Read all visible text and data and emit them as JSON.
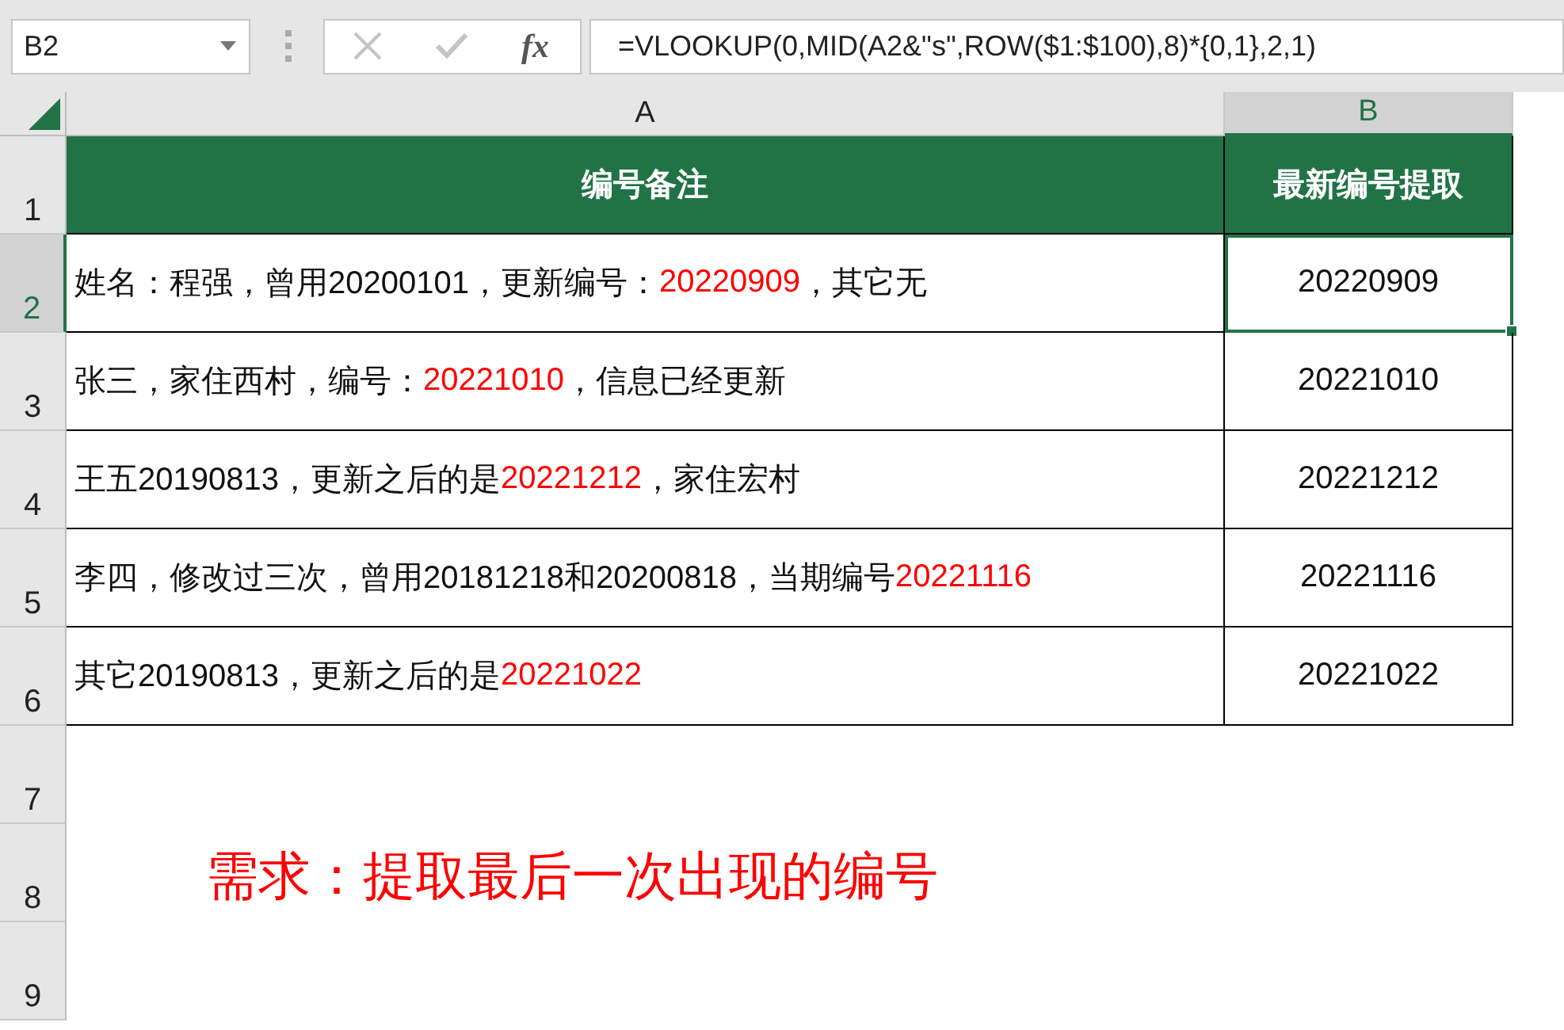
{
  "name_box": {
    "value": "B2"
  },
  "formula_bar": {
    "fx": "fx",
    "formula": "=VLOOKUP(0,MID(A2&\"s\",ROW($1:$100),8)*{0,1},2,1)"
  },
  "columns": [
    {
      "label": "A",
      "selected": false
    },
    {
      "label": "B",
      "selected": true
    }
  ],
  "rows": [
    {
      "number": "1",
      "selected": false,
      "kind": "header",
      "a": "编号备注",
      "b": "最新编号提取"
    },
    {
      "number": "2",
      "selected": true,
      "kind": "data",
      "a": [
        {
          "text": "姓名：程强，曾用20200101，更新编号：",
          "highlight": false
        },
        {
          "text": "20220909",
          "highlight": true
        },
        {
          "text": "，其它无",
          "highlight": false
        }
      ],
      "b": "20220909"
    },
    {
      "number": "3",
      "selected": false,
      "kind": "data",
      "a": [
        {
          "text": "张三，家住西村，编号：",
          "highlight": false
        },
        {
          "text": "20221010",
          "highlight": true
        },
        {
          "text": "，信息已经更新",
          "highlight": false
        }
      ],
      "b": "20221010"
    },
    {
      "number": "4",
      "selected": false,
      "kind": "data",
      "a": [
        {
          "text": "王五20190813，更新之后的是",
          "highlight": false
        },
        {
          "text": "20221212",
          "highlight": true
        },
        {
          "text": "，家住宏村",
          "highlight": false
        }
      ],
      "b": "20221212"
    },
    {
      "number": "5",
      "selected": false,
      "kind": "data",
      "a": [
        {
          "text": "李四，修改过三次，曾用20181218和20200818，当期编号",
          "highlight": false
        },
        {
          "text": "20221116",
          "highlight": true
        }
      ],
      "b": "20221116"
    },
    {
      "number": "6",
      "selected": false,
      "kind": "data",
      "a": [
        {
          "text": "其它20190813，更新之后的是",
          "highlight": false
        },
        {
          "text": "20221022",
          "highlight": true
        }
      ],
      "b": "20221022"
    },
    {
      "number": "7",
      "selected": false,
      "kind": "empty"
    },
    {
      "number": "8",
      "selected": false,
      "kind": "note",
      "a": "需求：提取最后一次出现的编号"
    },
    {
      "number": "9",
      "selected": false,
      "kind": "empty"
    }
  ]
}
